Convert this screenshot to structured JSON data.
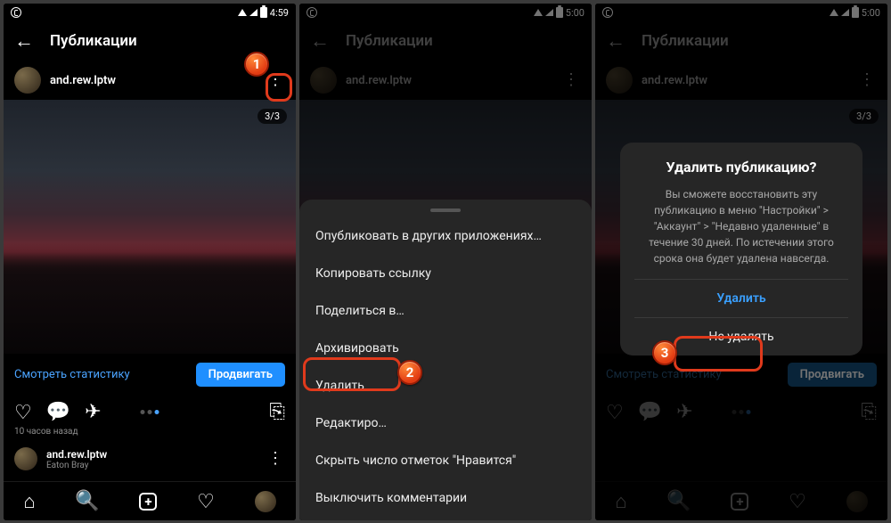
{
  "status": {
    "time1": "4:59",
    "time2": "5:00",
    "time3": "5:00"
  },
  "header": {
    "title": "Публикации"
  },
  "user": {
    "name": "and.rew.lptw"
  },
  "carousel": {
    "counter": "3/3"
  },
  "stats": {
    "link": "Смотреть статистику",
    "promote": "Продвигать"
  },
  "time": {
    "ago": "10 часов назад"
  },
  "author": {
    "name": "and.rew.lptw",
    "loc": "Eaton Bray"
  },
  "sheet": {
    "items": [
      "Опубликовать в других приложениях…",
      "Копировать ссылку",
      "Поделиться в…",
      "Архивировать",
      "Удалить",
      "Редактиро…",
      "Скрыть число отметок \"Нравится\"",
      "Выключить комментарии"
    ]
  },
  "dialog": {
    "title": "Удалить публикацию?",
    "body": "Вы сможете восстановить эту публикацию в меню \"Настройки\" > \"Аккаунт\" > \"Недавно удаленные\" в течение 30 дней. По истечении этого срока она будет удалена навсегда.",
    "primary": "Удалить",
    "secondary": "Не удалять"
  },
  "badges": {
    "one": "1",
    "two": "2",
    "three": "3"
  }
}
